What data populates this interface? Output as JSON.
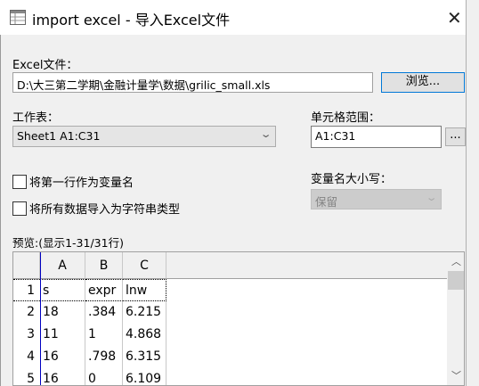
{
  "window": {
    "title": "import excel - 导入Excel文件",
    "close_icon": "close-icon",
    "app_icon": "table-icon"
  },
  "file": {
    "label": "Excel文件：",
    "path": "D:\\大三第二学期\\金融计量学\\数据\\grilic_small.xls",
    "browse_label": "浏览..."
  },
  "sheet": {
    "label": "工作表：",
    "value": "Sheet1 A1:C31"
  },
  "range": {
    "label": "单元格范围：",
    "value": "A1:C31",
    "picker_label": "..."
  },
  "options": {
    "first_row_names": {
      "label": "将第一行作为变量名",
      "checked": false
    },
    "all_string": {
      "label": "将所有数据导入为字符串类型",
      "checked": false
    }
  },
  "case": {
    "label": "变量名大小写：",
    "value": "保留",
    "disabled": true
  },
  "preview": {
    "label": "预览:(显示1-31/31行)",
    "columns": [
      "A",
      "B",
      "C"
    ],
    "rows": [
      {
        "n": "1",
        "cells": [
          "s",
          "expr",
          "lnw"
        ]
      },
      {
        "n": "2",
        "cells": [
          "18",
          ".384",
          "6.215"
        ]
      },
      {
        "n": "3",
        "cells": [
          "11",
          "1",
          "4.868"
        ]
      },
      {
        "n": "4",
        "cells": [
          "16",
          ".798",
          "6.315"
        ]
      },
      {
        "n": "5",
        "cells": [
          "16",
          "0",
          "6.109"
        ]
      }
    ]
  }
}
